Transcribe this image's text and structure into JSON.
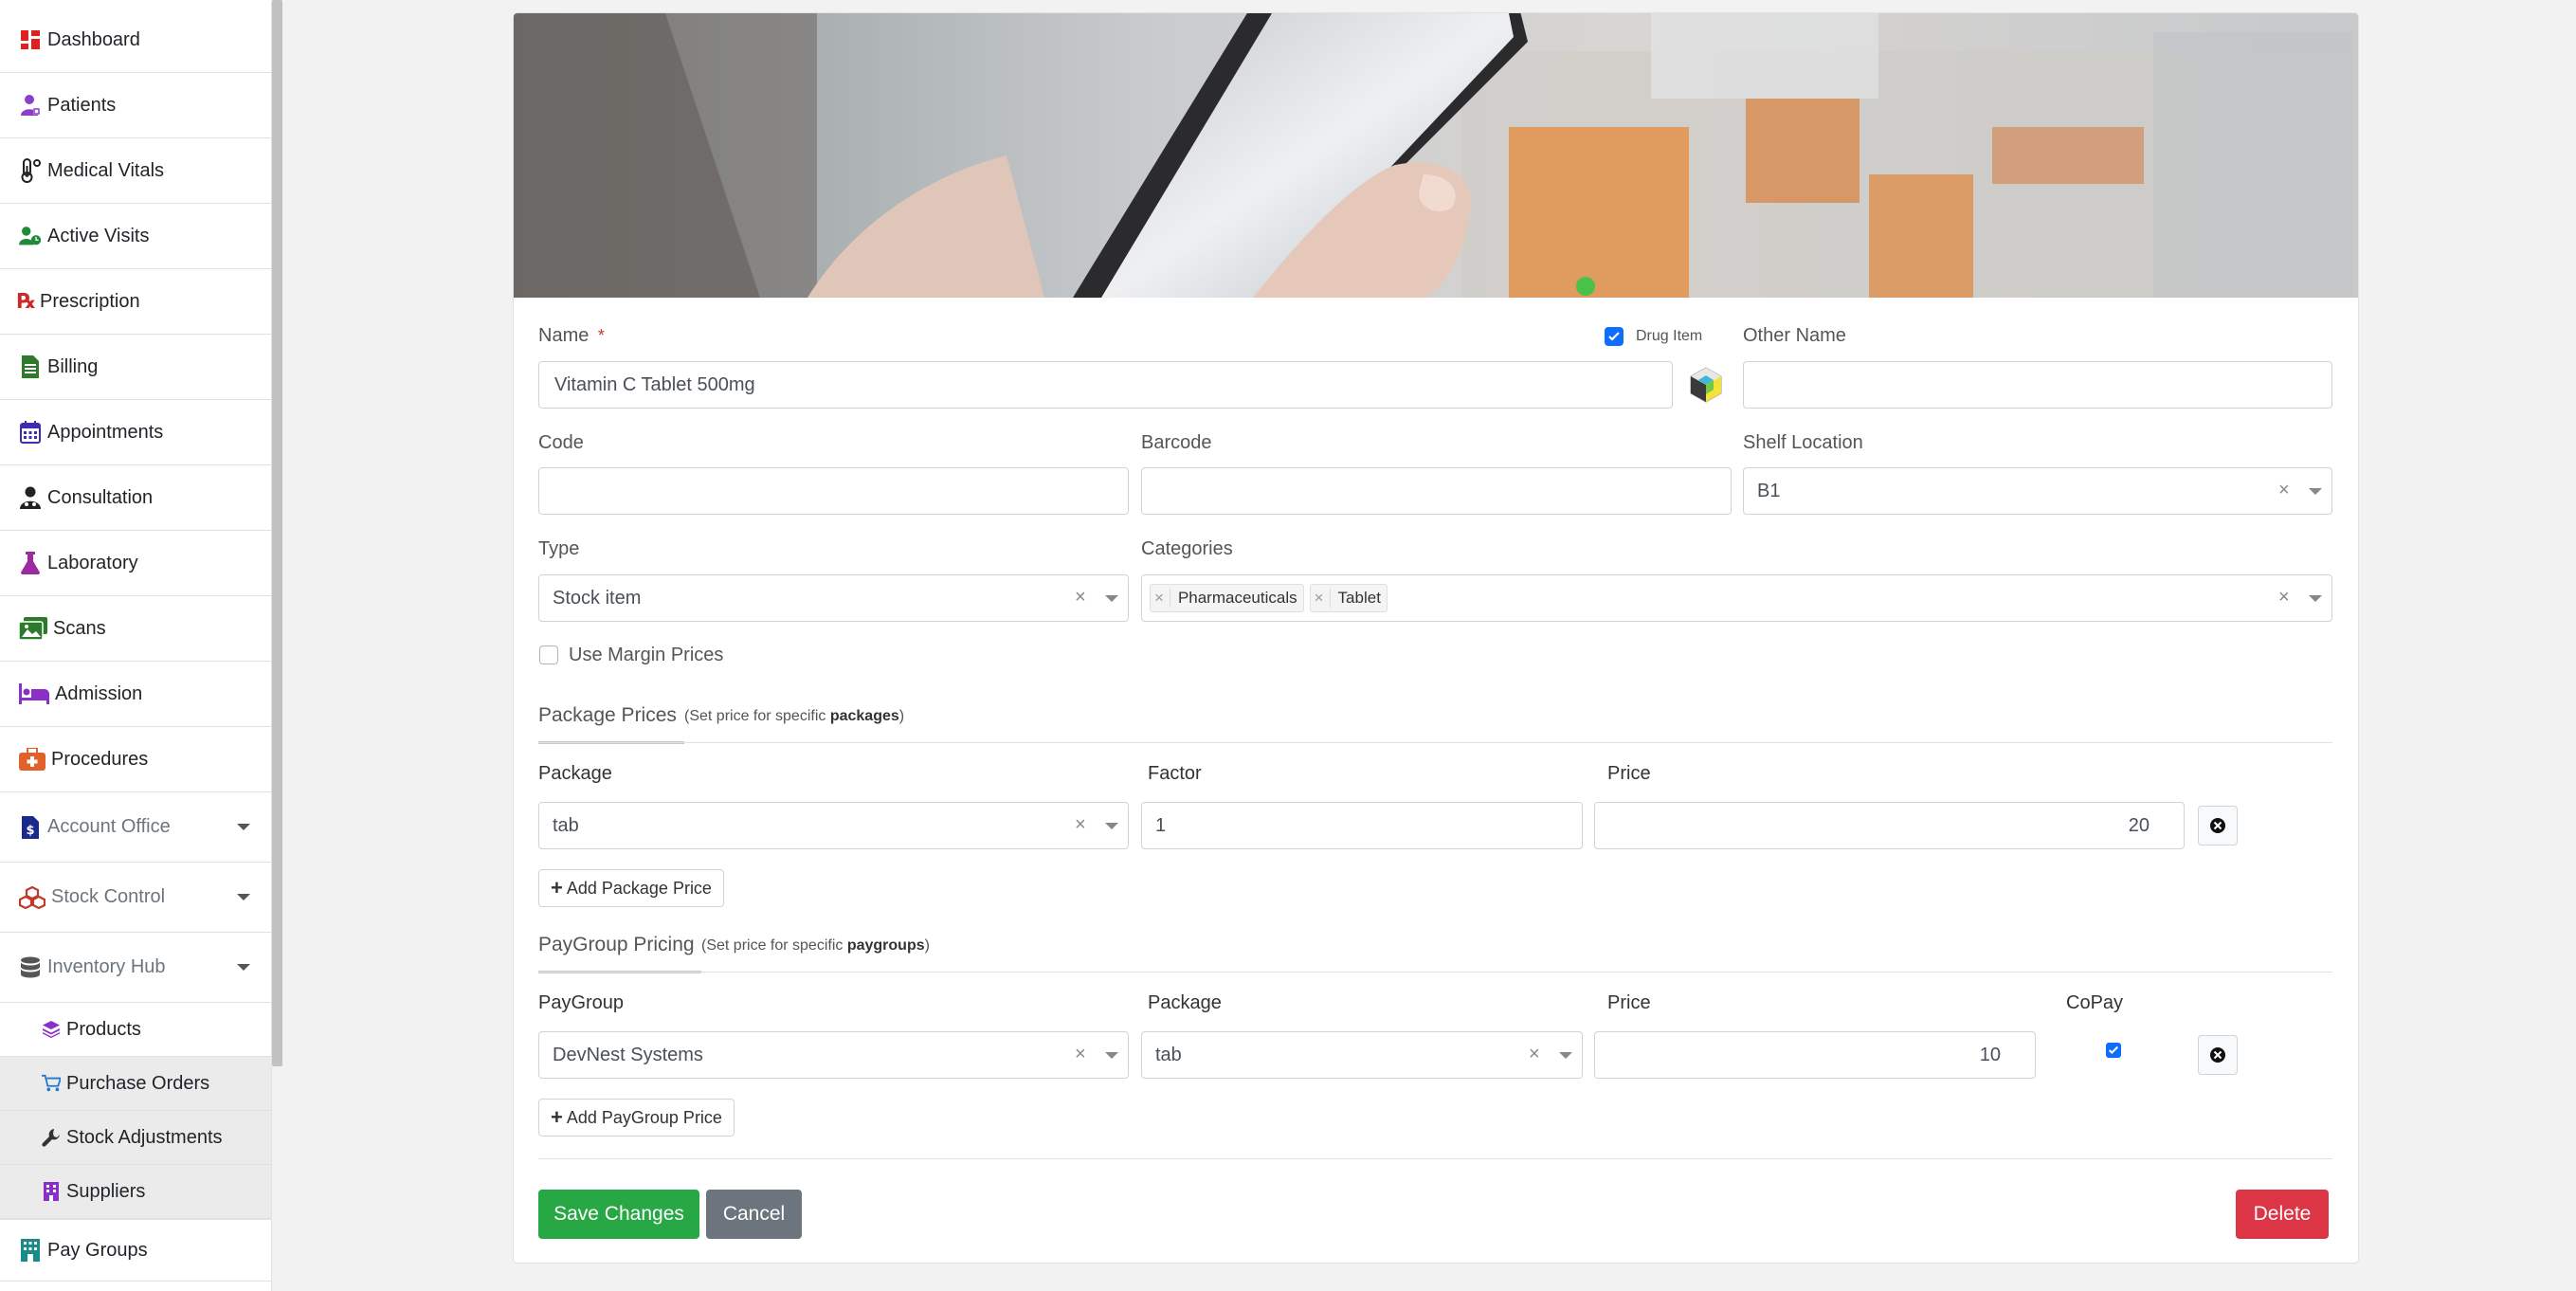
{
  "sidebar": {
    "items": [
      {
        "label": "Dashboard",
        "icon": "dashboard-icon"
      },
      {
        "label": "Patients",
        "icon": "patient-icon"
      },
      {
        "label": "Medical Vitals",
        "icon": "thermometer-icon"
      },
      {
        "label": "Active Visits",
        "icon": "user-clock-icon"
      },
      {
        "label": "Prescription",
        "icon": "prescription-icon"
      },
      {
        "label": "Billing",
        "icon": "invoice-icon"
      },
      {
        "label": "Appointments",
        "icon": "calendar-icon"
      },
      {
        "label": "Consultation",
        "icon": "doctor-icon"
      },
      {
        "label": "Laboratory",
        "icon": "flask-icon"
      },
      {
        "label": "Scans",
        "icon": "images-icon"
      },
      {
        "label": "Admission",
        "icon": "bed-icon"
      },
      {
        "label": "Procedures",
        "icon": "medkit-icon"
      },
      {
        "label": "Account Office",
        "icon": "money-file-icon"
      },
      {
        "label": "Stock Control",
        "icon": "cubes-icon"
      },
      {
        "label": "Inventory Hub",
        "icon": "database-icon"
      }
    ],
    "subitems": [
      {
        "label": "Products",
        "icon": "layers-icon"
      },
      {
        "label": "Purchase Orders",
        "icon": "cart-icon"
      },
      {
        "label": "Stock Adjustments",
        "icon": "wrench-icon"
      },
      {
        "label": "Suppliers",
        "icon": "building-icon"
      }
    ],
    "after": {
      "label": "Pay Groups",
      "icon": "hospital-building-icon"
    }
  },
  "form": {
    "name_label": "Name",
    "required_mark": "*",
    "drug_item_label": "Drug Item",
    "drug_item_checked": true,
    "name_value": "Vitamin C Tablet 500mg",
    "other_name_label": "Other Name",
    "other_name_value": "",
    "code_label": "Code",
    "code_value": "",
    "barcode_label": "Barcode",
    "barcode_value": "",
    "shelf_label": "Shelf Location",
    "shelf_value": "B1",
    "type_label": "Type",
    "type_value": "Stock item",
    "categories_label": "Categories",
    "categories": [
      "Pharmaceuticals",
      "Tablet"
    ],
    "clear_symbol": "×",
    "margin_label": "Use Margin Prices",
    "margin_checked": false
  },
  "package_prices": {
    "title": "Package Prices",
    "hint_prefix": "(Set price for specific ",
    "hint_bold": "packages",
    "hint_suffix": ")",
    "col_package": "Package",
    "col_factor": "Factor",
    "col_price": "Price",
    "row": {
      "package": "tab",
      "factor": "1",
      "price": "20"
    },
    "add_label": "Add Package Price"
  },
  "paygroup_pricing": {
    "title": "PayGroup Pricing",
    "hint_prefix": "(Set price for specific ",
    "hint_bold": "paygroups",
    "hint_suffix": ")",
    "col_paygroup": "PayGroup",
    "col_package": "Package",
    "col_price": "Price",
    "col_copay": "CoPay",
    "row": {
      "paygroup": "DevNest Systems",
      "package": "tab",
      "price": "10",
      "copay": true
    },
    "add_label": "Add PayGroup Price"
  },
  "actions": {
    "save": "Save Changes",
    "cancel": "Cancel",
    "delete": "Delete"
  },
  "colors": {
    "save": "#28a745",
    "cancel": "#6c757d",
    "delete": "#dc3545",
    "checkbox": "#0d6efd"
  }
}
